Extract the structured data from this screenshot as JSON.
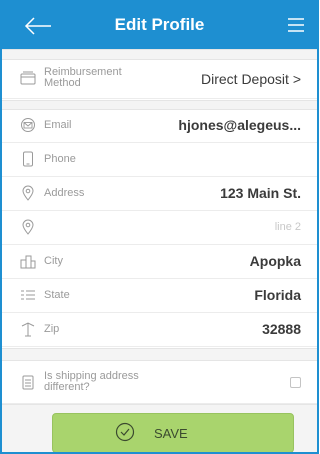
{
  "header": {
    "title": "Edit Profile",
    "back_icon": "arrow-left-icon",
    "menu_icon": "hamburger-menu-icon"
  },
  "reimbursement": {
    "label_line1": "Reimbursement",
    "label_line2": "Method",
    "value": "Direct Deposit",
    "chevron": ">"
  },
  "fields": {
    "email": {
      "label": "Email",
      "value": "hjones@alegeus..."
    },
    "phone": {
      "label": "Phone",
      "value": ""
    },
    "address": {
      "label": "Address",
      "value": "123 Main St."
    },
    "address2": {
      "placeholder": "line 2"
    },
    "city": {
      "label": "City",
      "value": "Apopka"
    },
    "state": {
      "label": "State",
      "value": "Florida"
    },
    "zip": {
      "label": "Zip",
      "value": "32888"
    }
  },
  "shipping": {
    "label_line1": "Is shipping address",
    "label_line2": "different?",
    "checked": false
  },
  "save_button": {
    "label": "SAVE"
  },
  "colors": {
    "header": "#1e8fd1",
    "save_button": "#a9d46d"
  }
}
